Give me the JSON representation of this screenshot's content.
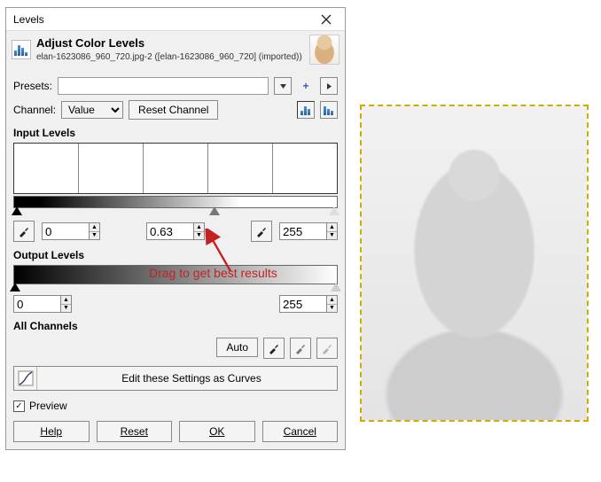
{
  "window": {
    "title": "Levels"
  },
  "header": {
    "title": "Adjust Color Levels",
    "subtitle": "elan-1623086_960_720.jpg-2 ([elan-1623086_960_720] (imported))"
  },
  "presets": {
    "label": "Presets:",
    "value": ""
  },
  "channel": {
    "label": "Channel:",
    "value": "Value",
    "reset_label": "Reset Channel"
  },
  "input_levels": {
    "label": "Input Levels",
    "low": "0",
    "gamma": "0.63",
    "high": "255"
  },
  "output_levels": {
    "label": "Output Levels",
    "low": "0",
    "high": "255"
  },
  "all_channels": {
    "label": "All Channels",
    "auto": "Auto"
  },
  "curves_label": "Edit these Settings as Curves",
  "preview_label": "Preview",
  "buttons": {
    "help": "Help",
    "reset": "Reset",
    "ok": "OK",
    "cancel": "Cancel"
  },
  "annotation": "Drag to get best results"
}
